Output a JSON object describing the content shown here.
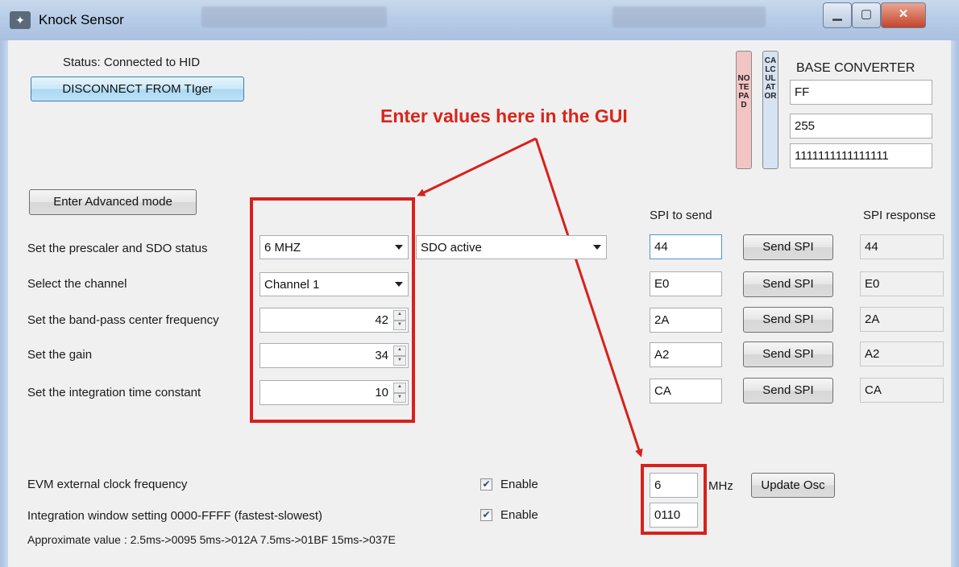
{
  "window": {
    "title": "Knock Sensor",
    "minimize": "▁",
    "maximize": "▢",
    "close": "✕"
  },
  "status": {
    "text": "Status: Connected to HID",
    "disconnect_label": "DISCONNECT FROM TIger"
  },
  "tools": {
    "notepad": "NOTEPAD",
    "calculator": "CALCULATOR"
  },
  "base_converter": {
    "title": "BASE CONVERTER",
    "hex": "FF",
    "dec": "255",
    "bin": "1111111111111111"
  },
  "annotation": "Enter values here in the GUI",
  "advanced_button": "Enter Advanced mode",
  "headers": {
    "spi_to_send": "SPI to send",
    "spi_response": "SPI response"
  },
  "rows": [
    {
      "label": "Set the prescaler and SDO status",
      "control": "6 MHZ",
      "spi": "44",
      "send": "Send SPI",
      "response": "44"
    },
    {
      "label": "Select the channel",
      "control": "Channel 1",
      "spi": "E0",
      "send": "Send SPI",
      "response": "E0"
    },
    {
      "label": "Set the band-pass center frequency",
      "control": "42",
      "spi": "2A",
      "send": "Send SPI",
      "response": "2A"
    },
    {
      "label": "Set the gain",
      "control": "34",
      "spi": "A2",
      "send": "Send SPI",
      "response": "A2"
    },
    {
      "label": "Set the integration time constant",
      "control": "10",
      "spi": "CA",
      "send": "Send SPI",
      "response": "CA"
    }
  ],
  "sdo_combo": "SDO active",
  "evm": {
    "label": "EVM external clock frequency",
    "enable": "Enable",
    "value": "6",
    "unit": "MHz",
    "update": "Update Osc",
    "checked": true
  },
  "integration": {
    "label": "Integration window setting 0000-FFFF (fastest-slowest)",
    "enable": "Enable",
    "value": "0110",
    "checked": true
  },
  "approx": "Approximate value : 2.5ms->0095  5ms->012A  7.5ms->01BF  15ms->037E",
  "colors": {
    "annotation": "#d9201c",
    "titlebar": "#b7cce6",
    "disconnect_button": "#bfe1f6"
  }
}
